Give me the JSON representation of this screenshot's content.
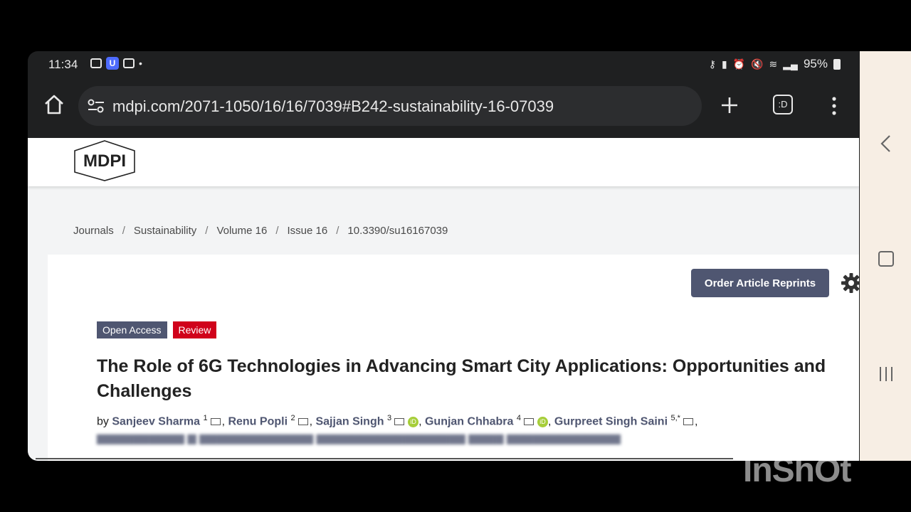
{
  "status_bar": {
    "time": "11:34",
    "battery": "95%"
  },
  "browser": {
    "url": "mdpi.com/2071-1050/16/16/7039#B242-sustainability-16-07039",
    "tabs_count": ":D"
  },
  "site": {
    "logo_text": "MDPI"
  },
  "breadcrumb": {
    "items": [
      "Journals",
      "Sustainability",
      "Volume 16",
      "Issue 16",
      "10.3390/su16167039"
    ],
    "separator": "/"
  },
  "article": {
    "reprint_label": "Order Article Reprints",
    "badge_open_access": "Open Access",
    "badge_review": "Review",
    "title": "The Role of 6G Technologies in Advancing Smart City Applications: Opportunities and Challenges",
    "by_label": "by",
    "authors": [
      {
        "name": "Sanjeev Sharma",
        "aff": "1"
      },
      {
        "name": "Renu Popli",
        "aff": "2"
      },
      {
        "name": "Sajjan Singh",
        "aff": "3"
      },
      {
        "name": "Gunjan Chhabra",
        "aff": "4"
      },
      {
        "name": "Gurpreet Singh Saini",
        "aff": "5,*"
      }
    ]
  },
  "watermark": "InShOt",
  "colors": {
    "accent": "#4f5671",
    "review_red": "#d0021b",
    "orcid_green": "#a6ce39"
  }
}
